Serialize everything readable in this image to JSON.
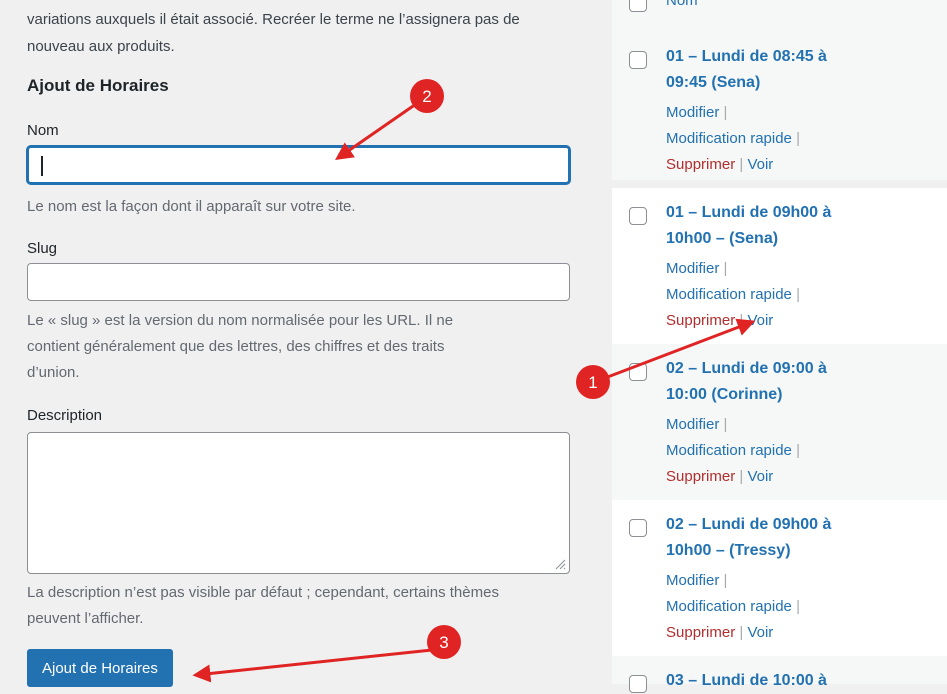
{
  "form": {
    "intro_line1": "variations auxquels il était associé. Recréer le terme ne l’assignera pas de",
    "intro_line2": "nouveau aux produits.",
    "title": "Ajout de Horaires",
    "name_label": "Nom",
    "name_value": "",
    "name_help": "Le nom est la façon dont il apparaît sur votre site.",
    "slug_label": "Slug",
    "slug_value": "",
    "slug_help_1": "Le « slug » est la version du nom normalisée pour les URL. Il ne",
    "slug_help_2": "contient généralement que des lettres, des chiffres et des traits",
    "slug_help_3": "d’union.",
    "desc_label": "Description",
    "desc_value": "",
    "desc_help_1": "La description n’est pas visible par défaut ; cependant, certains thèmes",
    "desc_help_2": "peuvent l’afficher.",
    "submit_label": "Ajout de Horaires"
  },
  "list": {
    "header_partial": "Nom",
    "action_edit": "Modifier",
    "action_quick": "Modification rapide",
    "action_delete": "Supprimer",
    "action_view": "Voir",
    "separator": "|",
    "items": [
      {
        "title_line1": "01 – Lundi de 08:45 à",
        "title_line2": "09:45 (Sena)"
      },
      {
        "title_line1": "01 – Lundi de 09h00 à",
        "title_line2": "10h00 – (Sena)"
      },
      {
        "title_line1": "02 – Lundi de 09:00 à",
        "title_line2": "10:00 (Corinne)"
      },
      {
        "title_line1": "02 – Lundi de 09h00 à",
        "title_line2": "10h00 – (Tressy)"
      },
      {
        "title_line1": "03 – Lundi de 10:00 à",
        "title_line2": ""
      }
    ]
  },
  "annotations": {
    "color": "#e02424",
    "badge_1": "1",
    "badge_2": "2",
    "badge_3": "3"
  },
  "colors": {
    "link": "#2271b1",
    "delete": "#b32d2e",
    "primary_button": "#2271b1",
    "background": "#f0f0f1"
  }
}
